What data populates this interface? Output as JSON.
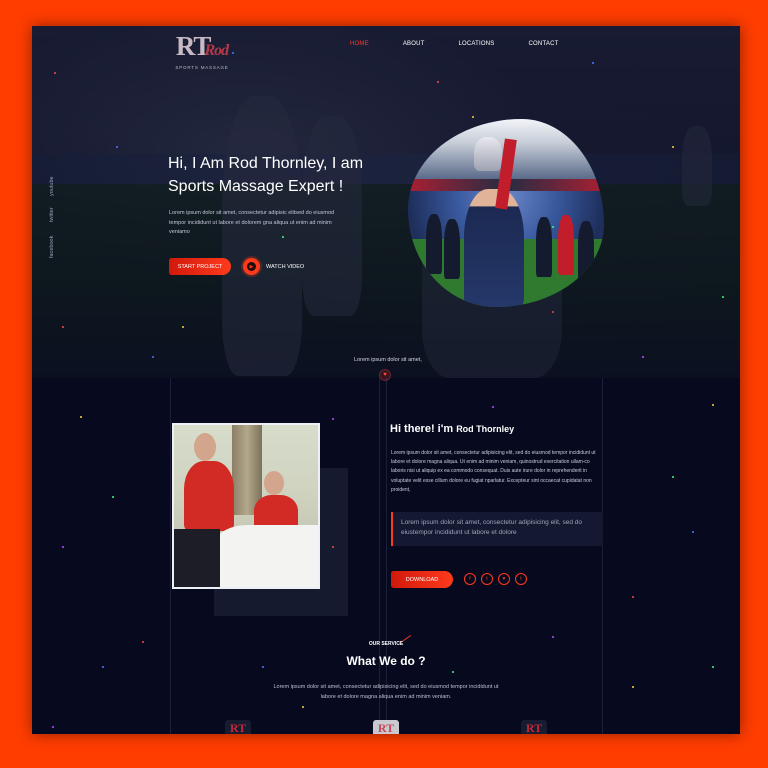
{
  "brand": {
    "logo_mark": "RT",
    "logo_script": "Rod",
    "logo_sub": "SPORTS MASSAGE"
  },
  "nav": {
    "items": [
      "HOME",
      "ABOUT",
      "LOCATIONS",
      "CONTACT"
    ],
    "active": "HOME"
  },
  "social_side": [
    "youtube",
    "twitter",
    "facebook"
  ],
  "hero": {
    "title": "Hi, I Am Rod Thornley, I am Sports Massage Expert !",
    "text": "Lorem ipsum dolor sit amet, consectetur adipisic elitsed do eiusmod tempor incididunt ut labore et dolorem gna aliqua ut enim ad minim veniamo",
    "start_button": "START PROJECT",
    "watch_label": "WATCH VIDEO",
    "caption": "Lorem ipsum dolor sit amet,"
  },
  "about": {
    "title_main": "Hi there! i'm ",
    "title_name": "Rod Thornley",
    "text": "Lorem ipsum dolor sit amet, consectetur adipisicing elit, sed do eiusmod tempor incididunt ut labore et dolore magna aliqua. Ut enim ad minim veniam, quinostrud exercitation ullam-co laboris nisi ut aliquip ex ea commodo consequat. Duis aute irure dolor in reprehenderit in voluptate velit esse cillum dolore eu fugiat nparlatur. Excepteur sint occaecat cupidatat non proident,",
    "quote": "Lorem ipsum dolor sit amet, consectetur adipisicing elit, sed do eiustempor incididunt ut labore et dolore",
    "download_button": "DOWNLOAD",
    "social_icons": [
      "f",
      "t",
      "♥",
      "t"
    ]
  },
  "services": {
    "kicker": "OUR SERVICE",
    "title": "What We do ?",
    "text": "Lorem ipsum dolor sit amet, consectetur adipisicing elit, sed do eiusmod tempor incididunt ut labore et dolore magna aliqua enim ad minim veniam.",
    "card_logo": "RT"
  },
  "colors": {
    "accent": "#ff3a1c",
    "background": "#070a1e",
    "outer_frame": "#ff3d00"
  }
}
